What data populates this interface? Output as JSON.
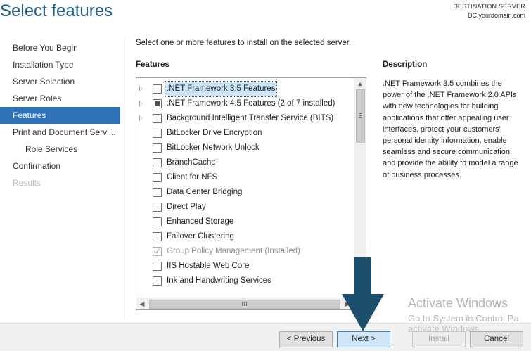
{
  "window": {
    "title": "Select features",
    "destination_label": "DESTINATION SERVER",
    "destination_server": "DC.yourdomain.com"
  },
  "nav": [
    {
      "label": "Before You Begin",
      "state": "normal"
    },
    {
      "label": "Installation Type",
      "state": "normal"
    },
    {
      "label": "Server Selection",
      "state": "normal"
    },
    {
      "label": "Server Roles",
      "state": "normal"
    },
    {
      "label": "Features",
      "state": "active"
    },
    {
      "label": "Print and Document Servi...",
      "state": "normal"
    },
    {
      "label": "Role Services",
      "state": "sub"
    },
    {
      "label": "Confirmation",
      "state": "normal"
    },
    {
      "label": "Results",
      "state": "disabled"
    }
  ],
  "main": {
    "intro": "Select one or more features to install on the selected server.",
    "features_heading": "Features",
    "features": [
      {
        "label": ".NET Framework 3.5 Features",
        "expandable": true,
        "check": "unchecked",
        "selected": true
      },
      {
        "label": ".NET Framework 4.5 Features (2 of 7 installed)",
        "expandable": true,
        "check": "partial"
      },
      {
        "label": "Background Intelligent Transfer Service (BITS)",
        "expandable": true,
        "check": "unchecked"
      },
      {
        "label": "BitLocker Drive Encryption",
        "check": "unchecked"
      },
      {
        "label": "BitLocker Network Unlock",
        "check": "unchecked"
      },
      {
        "label": "BranchCache",
        "check": "unchecked"
      },
      {
        "label": "Client for NFS",
        "check": "unchecked"
      },
      {
        "label": "Data Center Bridging",
        "check": "unchecked"
      },
      {
        "label": "Direct Play",
        "check": "unchecked"
      },
      {
        "label": "Enhanced Storage",
        "check": "unchecked"
      },
      {
        "label": "Failover Clustering",
        "check": "unchecked"
      },
      {
        "label": "Group Policy Management (Installed)",
        "check": "checked",
        "disabled": true
      },
      {
        "label": "IIS Hostable Web Core",
        "check": "unchecked"
      },
      {
        "label": "Ink and Handwriting Services",
        "check": "unchecked"
      }
    ],
    "description_heading": "Description",
    "description": ".NET Framework 3.5 combines the power of the .NET Framework 2.0 APIs with new technologies for building applications that offer appealing user interfaces, protect your customers' personal identity information, enable seamless and secure communication, and provide the ability to model a range of business processes."
  },
  "footer": {
    "previous": "< Previous",
    "next": "Next >",
    "install": "Install",
    "cancel": "Cancel"
  },
  "watermark": {
    "line1": "Activate Windows",
    "line2": "Go to System in Control Pa",
    "line3": "activate Windows."
  },
  "colors": {
    "title": "#1f5f8a",
    "nav_active": "#2f72b8",
    "arrow": "#1b4f6b",
    "selection": "#cde6f7"
  }
}
